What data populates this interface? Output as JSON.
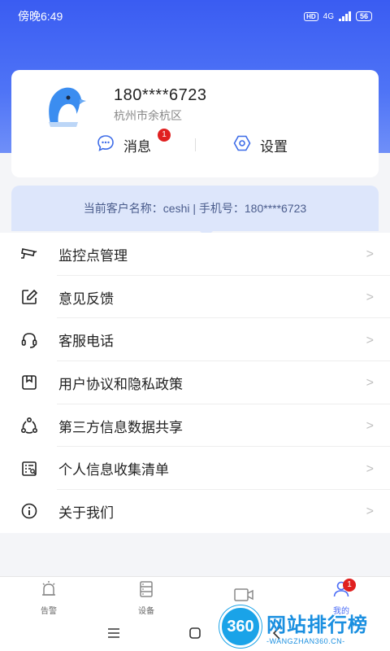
{
  "status_bar": {
    "time": "傍晚6:49",
    "hd": "HD",
    "network": "4G",
    "battery": "56"
  },
  "profile": {
    "phone": "180****6723",
    "district": "杭州市余杭区",
    "messages_label": "消息",
    "messages_badge": "1",
    "settings_label": "设置"
  },
  "info_strip": "当前客户名称：ceshi | 手机号：180****6723",
  "menu": [
    {
      "label": "监控点管理",
      "icon": "camera-icon"
    },
    {
      "label": "意见反馈",
      "icon": "edit-icon"
    },
    {
      "label": "客服电话",
      "icon": "headset-icon"
    },
    {
      "label": "用户协议和隐私政策",
      "icon": "bookmark-icon"
    },
    {
      "label": "第三方信息数据共享",
      "icon": "share-icon"
    },
    {
      "label": "个人信息收集清单",
      "icon": "list-icon"
    },
    {
      "label": "关于我们",
      "icon": "info-icon"
    }
  ],
  "chevron": ">",
  "tabbar": [
    {
      "label": "告警",
      "icon": "alarm-icon"
    },
    {
      "label": "设备",
      "icon": "device-icon"
    },
    {
      "label": "",
      "icon": "video-icon"
    },
    {
      "label": "我的",
      "icon": "user-icon",
      "badge": "1",
      "active": true
    }
  ],
  "watermark": {
    "logo_text": "360",
    "title": "网站排行榜",
    "subtitle": "-WANGZHAN360.CN-"
  },
  "colors": {
    "accent": "#4a6cf6",
    "badge": "#e02020",
    "header_top": "#3a5cf2"
  }
}
